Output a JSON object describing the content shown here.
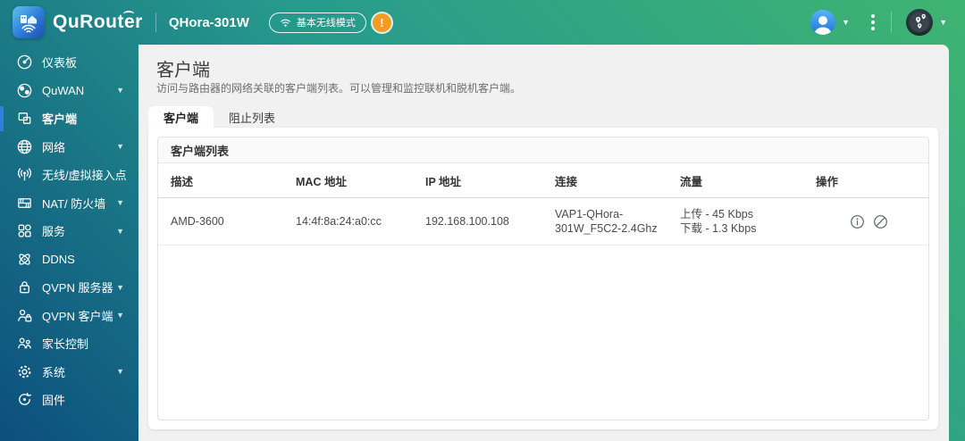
{
  "header": {
    "logo_text": "QuRouter",
    "device_name": "QHora-301W",
    "mode_badge": "基本无线模式",
    "warning_mark": "!"
  },
  "sidebar": {
    "items": [
      {
        "label": "仪表板",
        "icon": "dashboard-icon"
      },
      {
        "label": "QuWAN",
        "icon": "quwan-icon",
        "expandable": true
      },
      {
        "label": "客户端",
        "icon": "clients-icon",
        "active": true
      },
      {
        "label": "网络",
        "icon": "network-icon",
        "expandable": true
      },
      {
        "label": "无线/虚拟接入点",
        "icon": "wireless-ap-icon"
      },
      {
        "label": "NAT/ 防火墙",
        "icon": "firewall-icon",
        "expandable": true
      },
      {
        "label": "服务",
        "icon": "services-icon",
        "expandable": true
      },
      {
        "label": "DDNS",
        "icon": "ddns-icon"
      },
      {
        "label": "QVPN 服务器",
        "icon": "vpn-server-icon",
        "expandable": true
      },
      {
        "label": "QVPN 客户端",
        "icon": "vpn-client-icon",
        "expandable": true
      },
      {
        "label": "家长控制",
        "icon": "parental-icon"
      },
      {
        "label": "系统",
        "icon": "system-icon",
        "expandable": true
      },
      {
        "label": "固件",
        "icon": "firmware-icon"
      }
    ]
  },
  "main": {
    "title": "客户端",
    "description": "访问与路由器的网络关联的客户端列表。可以管理和监控联机和脱机客户端。",
    "tabs": [
      {
        "label": "客户端",
        "active": true
      },
      {
        "label": "阻止列表",
        "active": false
      }
    ],
    "client_list": {
      "title": "客户端列表",
      "columns": [
        "描述",
        "MAC 地址",
        "IP 地址",
        "连接",
        "流量",
        "操作"
      ],
      "rows": [
        {
          "description": "AMD-3600",
          "mac": "14:4f:8a:24:a0:cc",
          "ip": "192.168.100.108",
          "connection": "VAP1-QHora-301W_F5C2-2.4Ghz",
          "traffic_up": "上传 - 45 Kbps",
          "traffic_down": "下载 - 1.3 Kbps",
          "actions": [
            "info-icon",
            "block-icon"
          ]
        }
      ]
    }
  },
  "colors": {
    "gradient_top_right": "#3fb471",
    "gradient_mid": "#279b8d",
    "gradient_bottom_left": "#0c4f7e",
    "active_indicator_blue": "#2e7fe0",
    "warning_orange": "#f59b22",
    "panel_gray": "#f1f1f2",
    "avatar_blue": "#1877d2"
  }
}
